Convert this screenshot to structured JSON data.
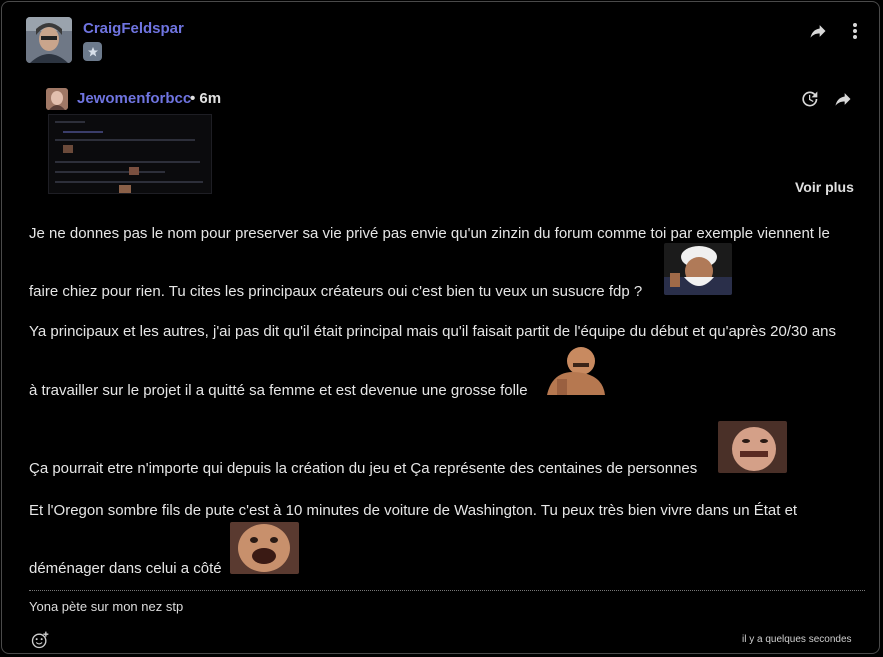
{
  "post": {
    "author": "CraigFeldspar",
    "footer_time": "il y a quelques secondes",
    "signature": "Yona pète sur mon nez stp"
  },
  "quote": {
    "author": "Jewomenforbcc",
    "time": "• 6m",
    "see_more": "Voir plus"
  },
  "body": {
    "lines": [
      "Je ne donnes pas le nom pour preserver sa vie privé pas envie qu'un zinzin du forum comme toi par exemple viennent le",
      "faire chiez pour rien. Tu cites les principaux créateurs oui c'est bien tu veux un susucre fdp ?",
      "Ya principaux et les autres, j'ai pas dit qu'il était principal mais qu'il faisait partit de l'équipe du début et qu'après 20/30 ans",
      "à travailler sur le projet il a quitté sa femme et est devenue une grosse folle",
      "Ça pourrait etre n'importe qui depuis la création du jeu et Ça représente des centaines de personnes",
      "Et l'Oregon sombre fils de pute c'est à 10 minutes de voiture de Washington. Tu peux très bien vivre dans un État et",
      "déménager dans celui a côté"
    ]
  },
  "icons": {
    "share": "share-icon",
    "more": "more-vertical-icon",
    "history": "history-icon",
    "badge": "star-badge-icon",
    "emoji": "add-reaction-icon"
  }
}
